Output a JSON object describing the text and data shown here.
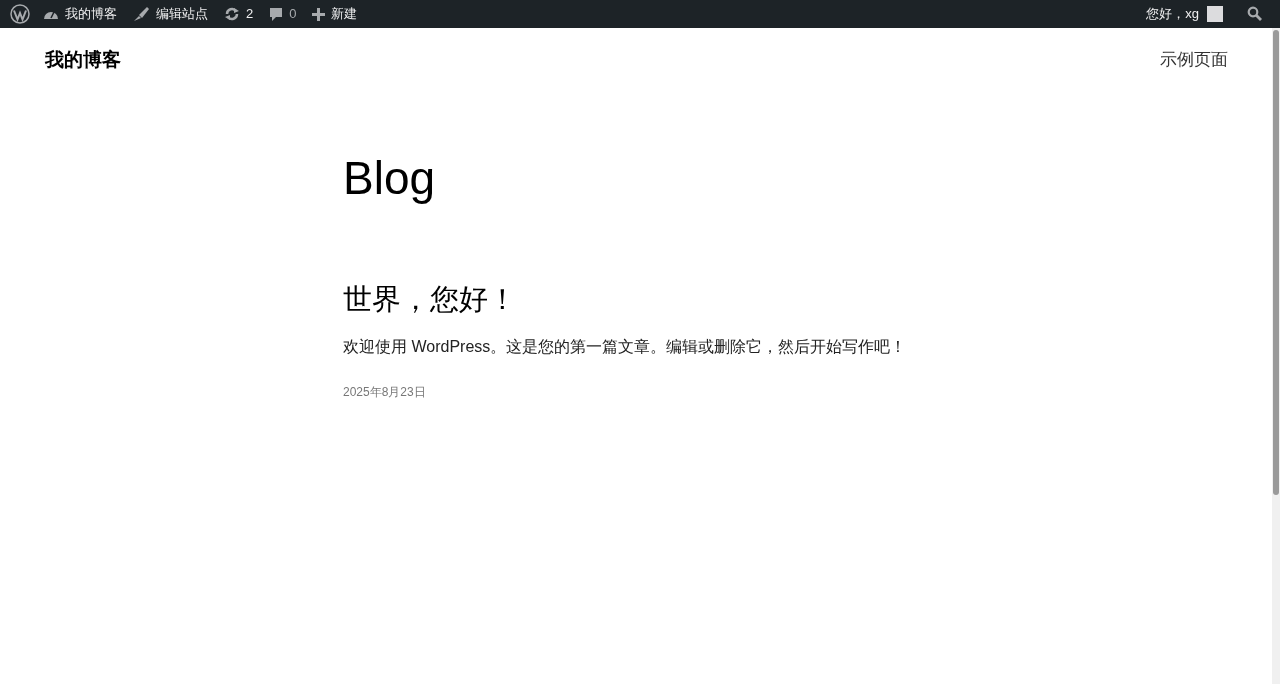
{
  "admin_bar": {
    "items": [
      {
        "kind": "site",
        "label": "我的博客"
      },
      {
        "kind": "customize",
        "label": "编辑站点"
      },
      {
        "kind": "updates",
        "label": "2"
      },
      {
        "kind": "comments",
        "label": "0"
      },
      {
        "kind": "new",
        "label": "新建"
      }
    ],
    "greeting": "您好，xg"
  },
  "header": {
    "site_title": "我的博客",
    "nav": [
      "示例页面"
    ]
  },
  "page_title": "Blog",
  "posts": [
    {
      "title": "世界，您好！",
      "excerpt": "欢迎使用 WordPress。这是您的第一篇文章。编辑或删除它，然后开始写作吧！",
      "date": "2025年8月23日"
    }
  ]
}
